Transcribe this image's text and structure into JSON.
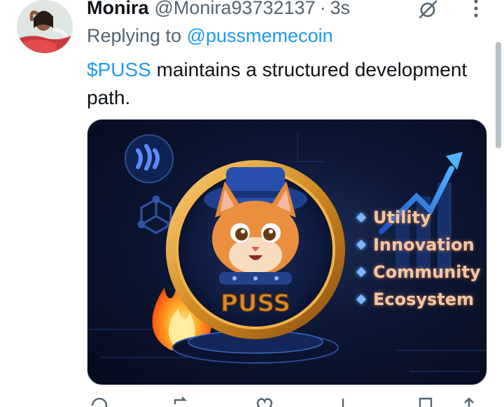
{
  "tweet": {
    "author_name": "Monira",
    "author_handle": "@Monira93732137",
    "separator": "·",
    "timestamp": "3s",
    "reply_prefix": "Replying to",
    "reply_to": "@pussmemecoin",
    "cashtag": "$PUSS",
    "body": " maintains a structured development path."
  },
  "media": {
    "coin_label": "PUSS",
    "features": [
      "Utility",
      "Innovation",
      "Community",
      "Ecosystem"
    ]
  },
  "icons": {
    "grok": "grok-icon",
    "more": "more-icon",
    "reply": "reply-icon",
    "repost": "repost-icon",
    "like": "like-icon",
    "views": "views-icon",
    "bookmark": "bookmark-icon",
    "share": "share-icon"
  },
  "colors": {
    "link": "#1d9bf0",
    "secondary_text": "#536471",
    "primary_text": "#0f1419"
  }
}
